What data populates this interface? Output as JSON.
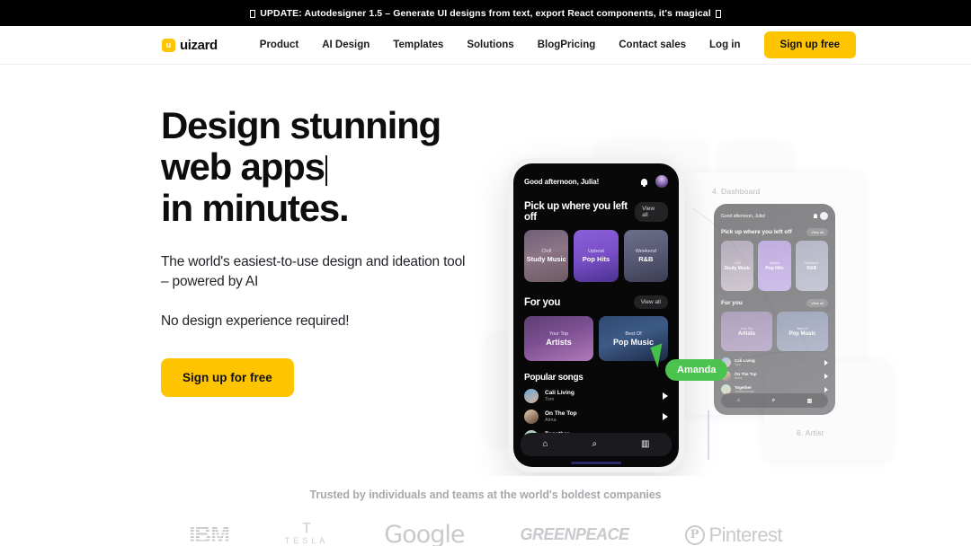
{
  "announcement": {
    "text": "UPDATE: Autodesigner 1.5 – Generate UI designs from text, export React components, it's magical",
    "leading_icon": "missing-glyph-box",
    "trailing_icon": "missing-glyph-box",
    "background": "#000000"
  },
  "header": {
    "logo_mark": "u",
    "logo_word": "uizard",
    "nav": [
      {
        "label": "Product"
      },
      {
        "label": "AI Design"
      },
      {
        "label": "Templates"
      },
      {
        "label": "Solutions"
      },
      {
        "label": "Blog"
      }
    ],
    "nav_right": [
      {
        "label": "Pricing"
      },
      {
        "label": "Contact sales"
      },
      {
        "label": "Log in"
      }
    ],
    "cta_label": "Sign up free",
    "accent_color": "#FFC400"
  },
  "hero": {
    "heading_line1": "Design stunning",
    "heading_line2": "web apps",
    "heading_line3": "in minutes.",
    "caret": true,
    "subtitle": "The world's easiest-to-use design and ideation tool – powered by AI",
    "subtitle2": "No design experience required!",
    "cta_label": "Sign up for free"
  },
  "mockup": {
    "screen_labels": [
      {
        "label": "4. Dashboard"
      },
      {
        "label": "6. Artist"
      }
    ],
    "cursor_label": "Amanda",
    "cursor_color": "#4CC24F",
    "phone": {
      "greeting": "Good afternoon, Julia!",
      "section1_title": "Pick up where you left off",
      "section1_action": "View all",
      "cards1": [
        {
          "sub": "Chill",
          "title": "Study Music"
        },
        {
          "sub": "Upbeat",
          "title": "Pop Hits"
        },
        {
          "sub": "Weekend",
          "title": "R&B"
        }
      ],
      "section2_title": "For you",
      "section2_action": "View all",
      "cards2": [
        {
          "sub": "Your Top",
          "title": "Artists"
        },
        {
          "sub": "Best Of",
          "title": "Pop Music"
        }
      ],
      "section3_title": "Popular songs",
      "songs": [
        {
          "name": "Cali Living",
          "artist": "Tom"
        },
        {
          "name": "On The Top",
          "artist": "Alma"
        },
        {
          "name": "Together",
          "artist": "Jonas&Jonas"
        }
      ],
      "tabs": [
        {
          "icon": "home-icon",
          "glyph": "⌂"
        },
        {
          "icon": "search-icon",
          "glyph": "⌕"
        },
        {
          "icon": "library-icon",
          "glyph": "▥"
        }
      ]
    }
  },
  "trusted": {
    "heading": "Trusted by individuals and teams at the world's boldest companies",
    "logos": [
      {
        "name": "IBM",
        "text": "IBM"
      },
      {
        "name": "Tesla",
        "glyph": "T",
        "text": "TESLA"
      },
      {
        "name": "Google",
        "text": "Google"
      },
      {
        "name": "Greenpeace",
        "text": "GREENPEACE"
      },
      {
        "name": "Pinterest",
        "mark": "P",
        "text": "Pinterest"
      }
    ]
  }
}
